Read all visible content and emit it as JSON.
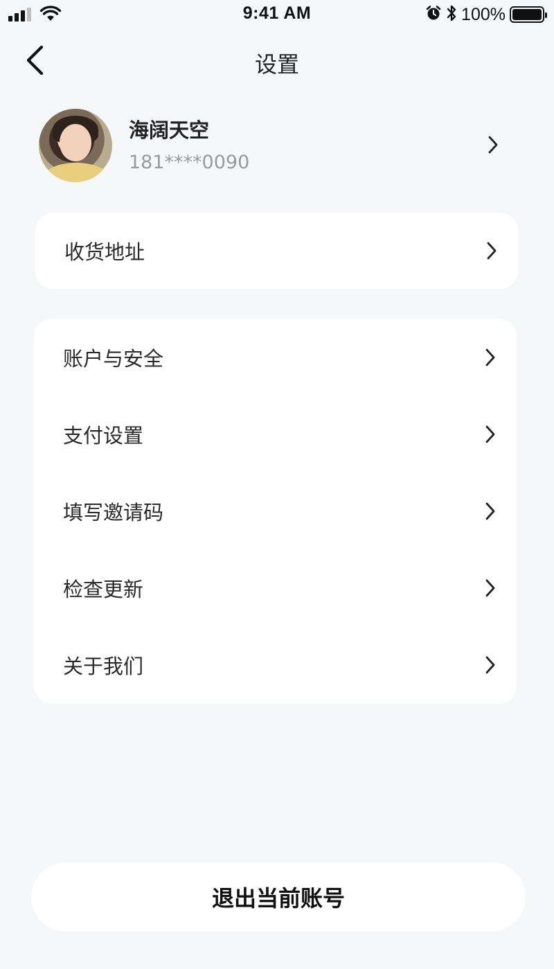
{
  "status_bar": {
    "time": "9:41 AM",
    "battery": "100%",
    "icons": [
      "signal-icon",
      "wifi-icon",
      "alarm-icon",
      "bluetooth-icon",
      "battery-icon"
    ]
  },
  "nav": {
    "title": "设置",
    "back_icon": "chevron-left-icon"
  },
  "profile": {
    "name": "海阔天空",
    "phone": "181****0090"
  },
  "address": {
    "label": "收货地址"
  },
  "menu": [
    {
      "label": "账户与安全"
    },
    {
      "label": "支付设置"
    },
    {
      "label": "填写邀请码"
    },
    {
      "label": "检查更新"
    },
    {
      "label": "关于我们"
    }
  ],
  "logout": {
    "label": "退出当前账号"
  },
  "colors": {
    "background": "#f6f7f9",
    "card": "#ffffff",
    "text": "#222222",
    "muted": "#9a9a9a"
  }
}
